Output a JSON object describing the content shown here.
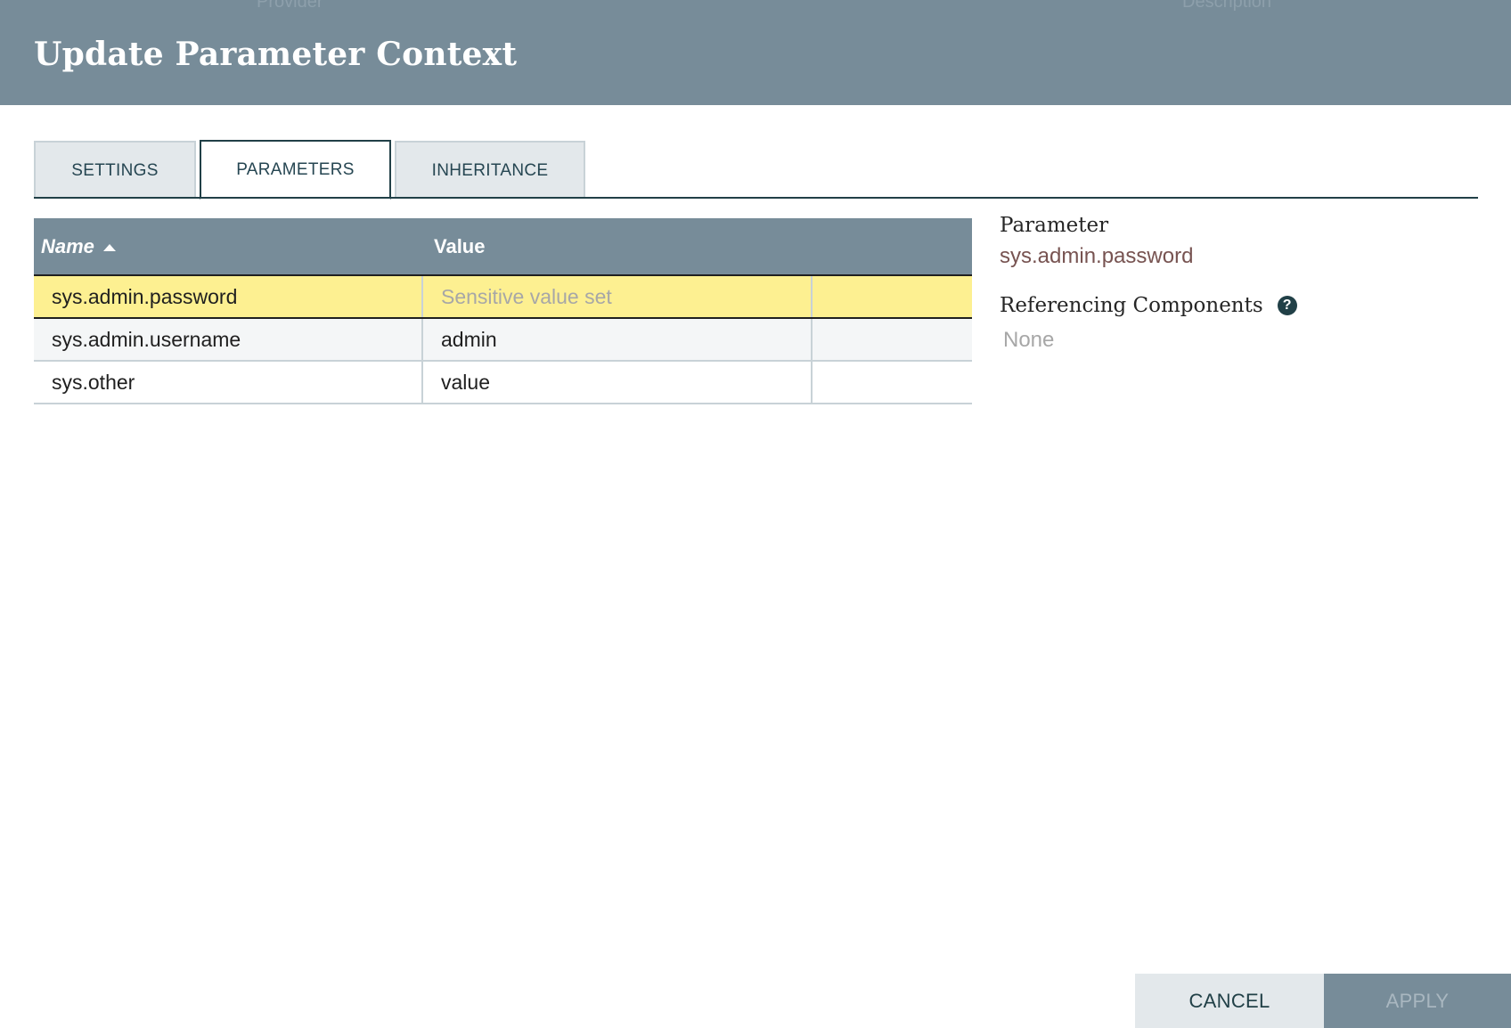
{
  "dialog": {
    "title": "Update Parameter Context",
    "background_hint_left": "Provider",
    "background_hint_right": "Description"
  },
  "tabs": [
    {
      "label": "SETTINGS",
      "active": false
    },
    {
      "label": "PARAMETERS",
      "active": true
    },
    {
      "label": "INHERITANCE",
      "active": false
    }
  ],
  "table": {
    "columns": {
      "name": "Name",
      "value": "Value"
    },
    "sort": {
      "column": "Name",
      "direction": "ascending"
    },
    "rows": [
      {
        "name": "sys.admin.password",
        "value": "Sensitive value set",
        "sensitive": true,
        "selected": true
      },
      {
        "name": "sys.admin.username",
        "value": "admin",
        "sensitive": false,
        "selected": false
      },
      {
        "name": "sys.other",
        "value": "value",
        "sensitive": false,
        "selected": false
      }
    ]
  },
  "details": {
    "parameter_label": "Parameter",
    "parameter_value": "sys.admin.password",
    "referencing_label": "Referencing Components",
    "referencing_value": "None",
    "help_icon": "question-circle-icon"
  },
  "buttons": {
    "cancel": "CANCEL",
    "apply": "APPLY",
    "apply_enabled": false
  },
  "colors": {
    "header": "#778c99",
    "accent": "#214047",
    "selected_row": "#fdf091",
    "parameter_name": "#775351"
  }
}
